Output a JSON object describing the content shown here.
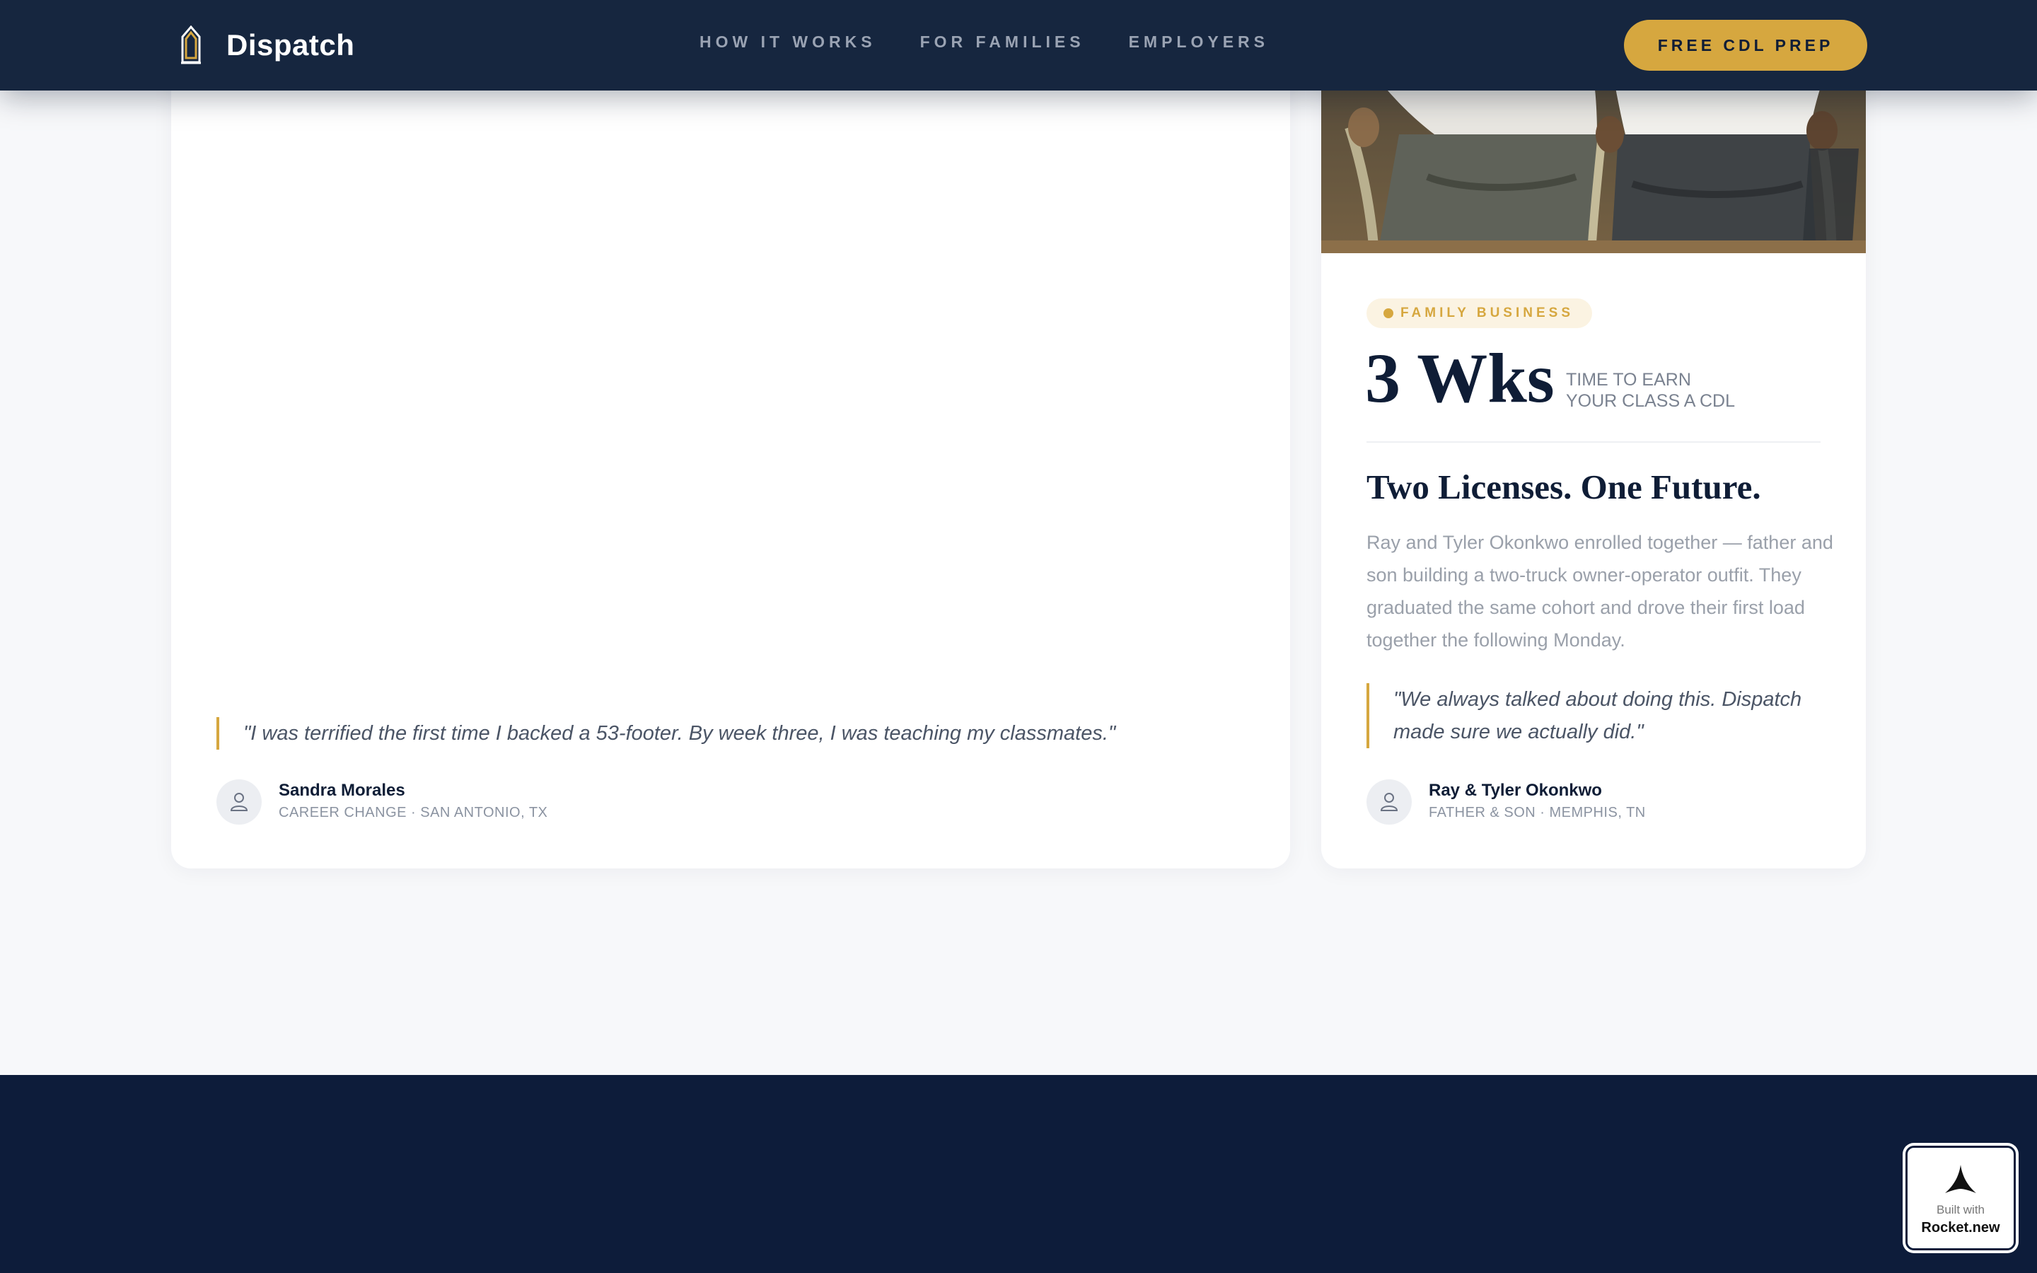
{
  "nav": {
    "brand": "Dispatch",
    "links": [
      "HOW IT WORKS",
      "FOR FAMILIES",
      "EMPLOYERS"
    ],
    "cta": "FREE CDL PREP"
  },
  "left_card": {
    "quote": "\"I was terrified the first time I backed a 53-footer. By week three, I was teaching my classmates.\"",
    "author_name": "Sandra Morales",
    "author_meta": "CAREER CHANGE · SAN ANTONIO, TX"
  },
  "right_card": {
    "badge": "FAMILY BUSINESS",
    "stat_value": "3 Wks",
    "stat_label_line1": "TIME TO EARN",
    "stat_label_line2": "YOUR CLASS A CDL",
    "headline": "Two Licenses. One Future.",
    "body": "Ray and Tyler Okonkwo enrolled together — father and son building a two-truck owner-operator outfit. They graduated the same cohort and drove their first load together the following Monday.",
    "quote": "\"We always talked about doing this. Dispatch made sure we actually did.\"",
    "author_name": "Ray & Tyler Okonkwo",
    "author_meta": "FATHER & SON · MEMPHIS, TN"
  },
  "built_with": {
    "small": "Built with",
    "big": "Rocket.new"
  },
  "colors": {
    "navy": "#0f1d36",
    "nav_bg": "#16263f",
    "accent_gold": "#d6a73f",
    "footer_bg": "#0d1c3a"
  }
}
